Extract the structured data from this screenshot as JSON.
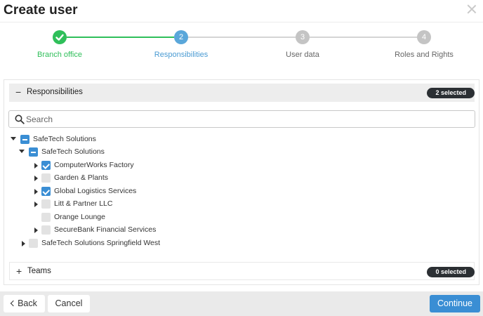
{
  "dialog": {
    "title": "Create user"
  },
  "stepper": {
    "steps": [
      {
        "number": "✓",
        "label": "Branch office",
        "state": "done",
        "color": "#2fbf5a"
      },
      {
        "number": "2",
        "label": "Responsibilities",
        "state": "active",
        "color": "#5aa7da"
      },
      {
        "number": "3",
        "label": "User data",
        "state": "pending",
        "color": "#c4c4c4"
      },
      {
        "number": "4",
        "label": "Roles and Rights",
        "state": "pending",
        "color": "#c4c4c4"
      }
    ]
  },
  "responsibilities": {
    "sign": "−",
    "label": "Responsibilities",
    "badge": "2 selected",
    "search_placeholder": "Search",
    "tree": [
      {
        "label": "SafeTech Solutions",
        "expand": "down",
        "check": "partial"
      },
      {
        "label": "SafeTech Solutions",
        "expand": "down",
        "check": "partial"
      },
      {
        "label": "ComputerWorks Factory",
        "expand": "right",
        "check": "checked"
      },
      {
        "label": "Garden & Plants",
        "expand": "right",
        "check": "empty"
      },
      {
        "label": "Global Logistics Services",
        "expand": "right",
        "check": "checked"
      },
      {
        "label": "Litt & Partner LLC",
        "expand": "right",
        "check": "empty"
      },
      {
        "label": "Orange Lounge",
        "expand": "none",
        "check": "empty"
      },
      {
        "label": "SecureBank Financial Services",
        "expand": "right",
        "check": "empty"
      },
      {
        "label": "SafeTech Solutions Springfield West",
        "expand": "right",
        "check": "empty"
      }
    ]
  },
  "teams": {
    "sign": "+",
    "label": "Teams",
    "badge": "0 selected"
  },
  "footer": {
    "back_label": "Back",
    "cancel_label": "Cancel",
    "continue_label": "Continue"
  },
  "colors": {
    "accent": "#3a8ed4",
    "success": "#2fbf5a",
    "pending": "#c4c4c4"
  }
}
